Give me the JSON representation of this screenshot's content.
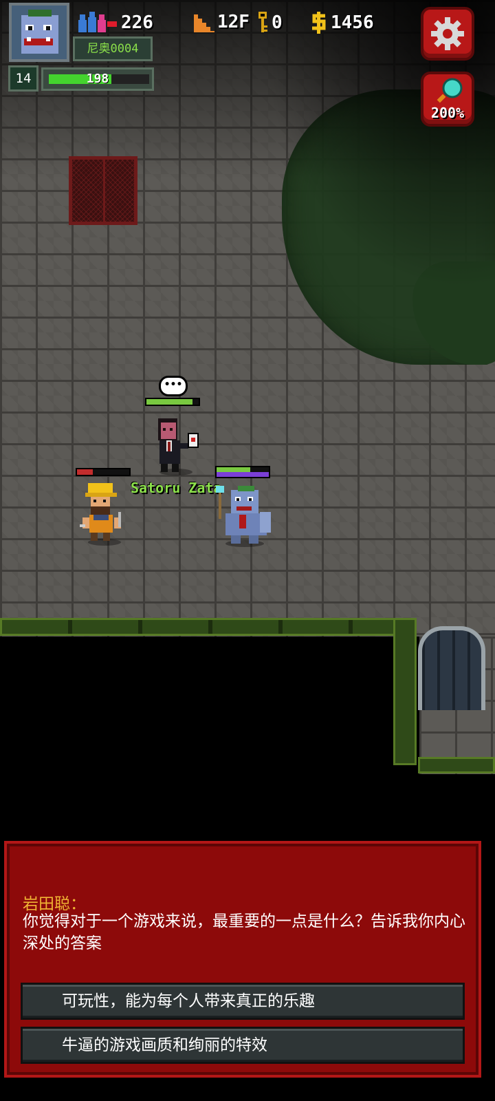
{
  "hud": {
    "team_count": "226",
    "name_tag": "尼奥0004",
    "level": "14",
    "hp": "198",
    "hp_fraction": 0.62,
    "floor": "12F",
    "keys": "0",
    "gold": "1456",
    "zoom": "200%"
  },
  "scene": {
    "npc_name": "Satoru Zata",
    "speech_icon": "•••"
  },
  "dialog": {
    "speaker": "岩田聪：",
    "line": "你觉得对于一个游戏来说，最重要的一点是什么？告诉我你内心深处的答案",
    "choices": [
      {
        "label": "可玩性，能为每个人带来真正的乐趣"
      },
      {
        "label": "牛逼的游戏画质和绚丽的特效"
      }
    ]
  },
  "colors": {
    "dialog_bg": "#8d0a0a",
    "speaker": "#f0b534",
    "npc_label": "#8be04a",
    "hud_button": "#b81818"
  },
  "icons": {
    "team": "team-icon",
    "floor": "stairs-icon",
    "key": "key-icon",
    "gold": "gold-icon",
    "settings": "gear-icon",
    "zoom": "magnifier-icon"
  }
}
